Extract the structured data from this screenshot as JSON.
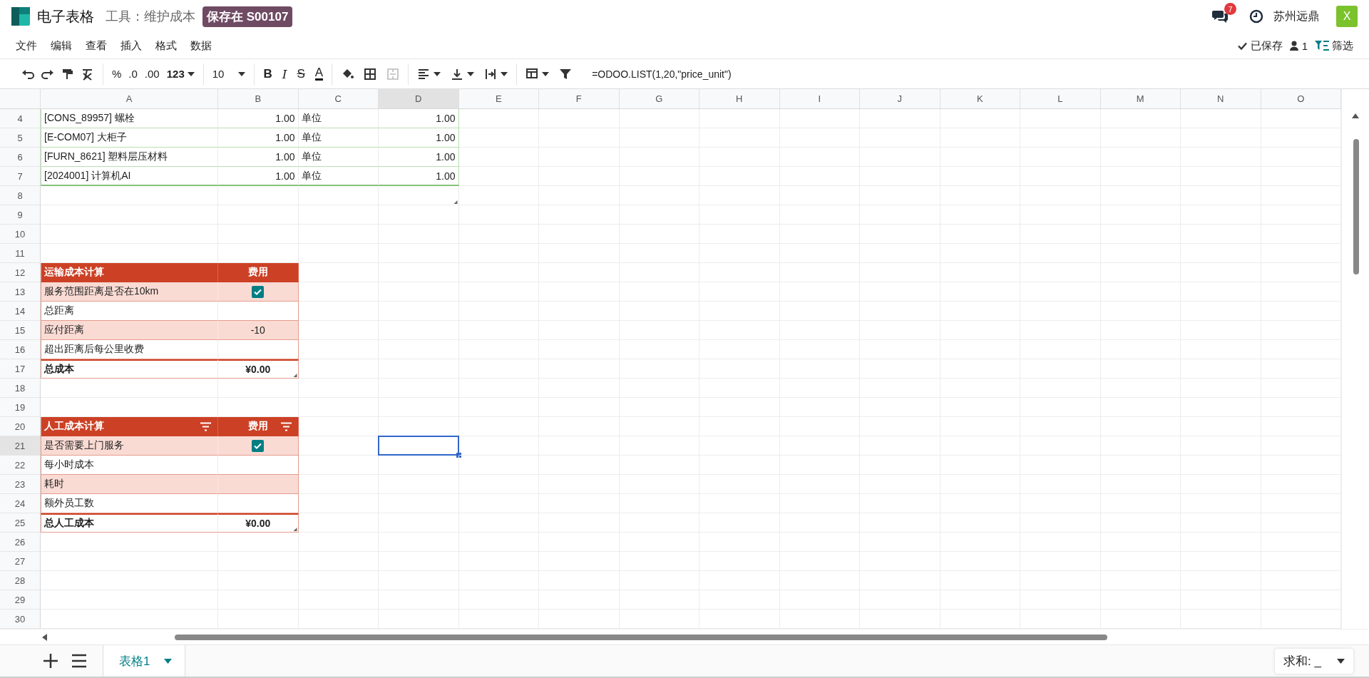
{
  "app": {
    "title": "电子表格",
    "breadcrumb": "工具：维护成本",
    "badge": "保存在 S00107",
    "notifications": "7",
    "company": "苏州远鼎",
    "avatar": "X"
  },
  "menu": [
    "文件",
    "编辑",
    "查看",
    "插入",
    "格式",
    "数据"
  ],
  "status": {
    "saved": "已保存",
    "users": "1",
    "filter": "筛选"
  },
  "toolbar": {
    "number_formats": [
      "%",
      ".0",
      ".00",
      "123"
    ],
    "font_size": "10",
    "styles": [
      {
        "label": "B",
        "kind": "bold"
      },
      {
        "label": "I",
        "kind": "italic"
      },
      {
        "label": "S",
        "kind": "strike"
      },
      {
        "label": "A",
        "kind": "color"
      }
    ],
    "formula": "=ODOO.LIST(1,20,\"price_unit\")"
  },
  "sheet": {
    "columns": [
      {
        "label": "A",
        "selected": false
      },
      {
        "label": "B",
        "selected": false
      },
      {
        "label": "C",
        "selected": false
      },
      {
        "label": "D",
        "selected": true
      },
      {
        "label": "E",
        "selected": false
      },
      {
        "label": "F",
        "selected": false
      },
      {
        "label": "G",
        "selected": false
      },
      {
        "label": "H",
        "selected": false
      },
      {
        "label": "I",
        "selected": false
      },
      {
        "label": "J",
        "selected": false
      },
      {
        "label": "K",
        "selected": false
      },
      {
        "label": "L",
        "selected": false
      },
      {
        "label": "M",
        "selected": false
      },
      {
        "label": "N",
        "selected": false
      },
      {
        "label": "O",
        "selected": false
      }
    ],
    "rows": [
      {
        "number": "4",
        "selected": false,
        "kind": "list",
        "cells": [
          {
            "text": "[CONS_89957] 螺栓"
          },
          {
            "text": "1.00"
          },
          {
            "text": "单位"
          },
          {
            "text": "1.00"
          }
        ]
      },
      {
        "number": "5",
        "selected": false,
        "kind": "list",
        "cells": [
          {
            "text": "[E-COM07] 大柜子"
          },
          {
            "text": "1.00"
          },
          {
            "text": "单位"
          },
          {
            "text": "1.00"
          }
        ]
      },
      {
        "number": "6",
        "selected": false,
        "kind": "list",
        "cells": [
          {
            "text": "[FURN_8621] 塑料层压材料"
          },
          {
            "text": "1.00"
          },
          {
            "text": "单位"
          },
          {
            "text": "1.00"
          }
        ]
      },
      {
        "number": "7",
        "selected": false,
        "kind": "list-end",
        "cells": [
          {
            "text": "[2024001] 计算机AI"
          },
          {
            "text": "1.00"
          },
          {
            "text": "单位"
          },
          {
            "text": "1.00"
          }
        ]
      },
      {
        "number": "8",
        "selected": false,
        "kind": "list-tail"
      },
      {
        "number": "9",
        "selected": false
      },
      {
        "number": "10",
        "selected": false
      },
      {
        "number": "11",
        "selected": false
      },
      {
        "number": "12",
        "selected": false,
        "kind": "head",
        "cells": [
          {
            "text": "运输成本计算",
            "filter": false
          },
          {
            "text": "费用",
            "filter": false
          }
        ]
      },
      {
        "number": "13",
        "selected": false,
        "kind": "band",
        "cells": [
          {
            "text": "服务范围距离是否在10km"
          },
          {
            "kind": "check",
            "checked": true
          }
        ]
      },
      {
        "number": "14",
        "selected": false,
        "kind": "plain",
        "cells": [
          {
            "text": "总距离"
          }
        ]
      },
      {
        "number": "15",
        "selected": false,
        "kind": "band",
        "cells": [
          {
            "text": "应付距离"
          },
          {
            "text": "-10"
          }
        ]
      },
      {
        "number": "16",
        "selected": false,
        "kind": "plain",
        "cells": [
          {
            "text": "超出距离后每公里收费"
          }
        ]
      },
      {
        "number": "17",
        "selected": false,
        "kind": "total",
        "cells": [
          {
            "text": "总成本"
          },
          {
            "text": "¥0.00"
          }
        ]
      },
      {
        "number": "18",
        "selected": false
      },
      {
        "number": "19",
        "selected": false
      },
      {
        "number": "20",
        "selected": false,
        "kind": "head",
        "cells": [
          {
            "text": "人工成本计算",
            "filter": true
          },
          {
            "text": "费用",
            "filter": true
          }
        ]
      },
      {
        "number": "21",
        "selected": true,
        "kind": "band",
        "cells": [
          {
            "text": "是否需要上门服务"
          },
          {
            "kind": "check",
            "checked": true
          }
        ]
      },
      {
        "number": "22",
        "selected": false,
        "kind": "plain",
        "cells": [
          {
            "text": "每小时成本"
          }
        ]
      },
      {
        "number": "23",
        "selected": false,
        "kind": "band",
        "cells": [
          {
            "text": "耗时"
          }
        ]
      },
      {
        "number": "24",
        "selected": false,
        "kind": "plain",
        "cells": [
          {
            "text": "额外员工数"
          }
        ]
      },
      {
        "number": "25",
        "selected": false,
        "kind": "total",
        "cells": [
          {
            "text": "总人工成本"
          },
          {
            "text": "¥0.00"
          }
        ]
      },
      {
        "number": "26",
        "selected": false
      },
      {
        "number": "27",
        "selected": false
      },
      {
        "number": "28",
        "selected": false
      },
      {
        "number": "29",
        "selected": false
      },
      {
        "number": "30",
        "selected": false
      }
    ]
  },
  "footer": {
    "tabs": [
      {
        "label": "表格1",
        "selected": true
      }
    ],
    "aggregate": "求和: _"
  }
}
